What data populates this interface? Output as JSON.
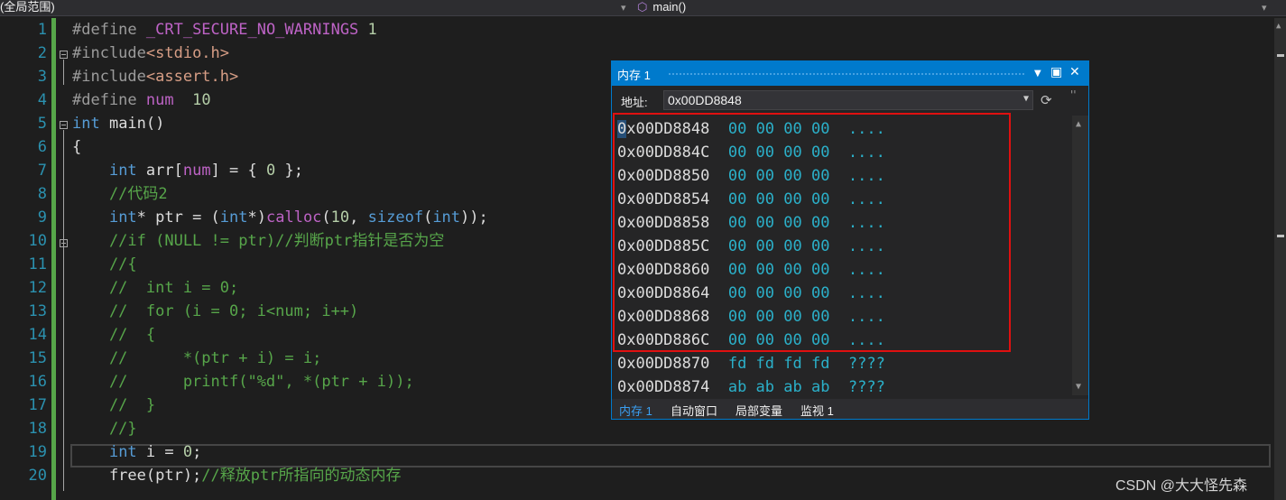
{
  "scope_bar": {
    "scope": "(全局范围)",
    "function": "main()"
  },
  "code": {
    "line_numbers": [
      "1",
      "2",
      "3",
      "4",
      "5",
      "6",
      "7",
      "8",
      "9",
      "10",
      "11",
      "12",
      "13",
      "14",
      "15",
      "16",
      "17",
      "18",
      "19",
      "20"
    ],
    "lines": [
      [
        [
          "pp",
          "#define "
        ],
        [
          "mac",
          "_CRT_SECURE_NO_WARNINGS"
        ],
        [
          "pl",
          " "
        ],
        [
          "num",
          "1"
        ]
      ],
      [
        [
          "pp",
          "#include"
        ],
        [
          "str",
          "<stdio.h>"
        ]
      ],
      [
        [
          "pp",
          "#include"
        ],
        [
          "str",
          "<assert.h>"
        ]
      ],
      [
        [
          "pp",
          "#define "
        ],
        [
          "mac",
          "num"
        ],
        [
          "pl",
          "  "
        ],
        [
          "num",
          "10"
        ]
      ],
      [
        [
          "kw",
          "int"
        ],
        [
          "pl",
          " main()"
        ]
      ],
      [
        [
          "pl",
          "{"
        ]
      ],
      [
        [
          "pl",
          "    "
        ],
        [
          "kw",
          "int"
        ],
        [
          "pl",
          " arr["
        ],
        [
          "mac",
          "num"
        ],
        [
          "pl",
          "] = { "
        ],
        [
          "num",
          "0"
        ],
        [
          "pl",
          " };"
        ]
      ],
      [
        [
          "cm",
          "    //代码2"
        ]
      ],
      [
        [
          "pl",
          "    "
        ],
        [
          "kw",
          "int"
        ],
        [
          "pl",
          "* ptr = ("
        ],
        [
          "kw",
          "int"
        ],
        [
          "pl",
          "*)"
        ],
        [
          "mac",
          "calloc"
        ],
        [
          "pl",
          "("
        ],
        [
          "num",
          "10"
        ],
        [
          "pl",
          ", "
        ],
        [
          "kw",
          "sizeof"
        ],
        [
          "pl",
          "("
        ],
        [
          "kw",
          "int"
        ],
        [
          "pl",
          "));"
        ]
      ],
      [
        [
          "cm",
          "    //if (NULL != ptr)//判断ptr指针是否为空"
        ]
      ],
      [
        [
          "cm",
          "    //{"
        ]
      ],
      [
        [
          "cm",
          "    //  int i = 0;"
        ]
      ],
      [
        [
          "cm",
          "    //  for (i = 0; i<num; i++)"
        ]
      ],
      [
        [
          "cm",
          "    //  {"
        ]
      ],
      [
        [
          "cm",
          "    //      *(ptr + i) = i;"
        ]
      ],
      [
        [
          "cm",
          "    //      printf(\"%d\", *(ptr + i));"
        ]
      ],
      [
        [
          "cm",
          "    //  }"
        ]
      ],
      [
        [
          "cm",
          "    //}"
        ]
      ],
      [
        [
          "pl",
          "    "
        ],
        [
          "kw",
          "int"
        ],
        [
          "pl",
          " i = "
        ],
        [
          "num",
          "0"
        ],
        [
          "pl",
          ";"
        ]
      ],
      [
        [
          "pl",
          "    free(ptr);"
        ],
        [
          "cm",
          "//释放ptr所指向的动态内存"
        ]
      ]
    ]
  },
  "memory_window": {
    "title": "内存 1",
    "address_label": "地址:",
    "address_value": "0x00DD8848",
    "rows": [
      {
        "addr": "0x00DD8848",
        "bytes": "00 00 00 00",
        "ascii": "...."
      },
      {
        "addr": "0x00DD884C",
        "bytes": "00 00 00 00",
        "ascii": "...."
      },
      {
        "addr": "0x00DD8850",
        "bytes": "00 00 00 00",
        "ascii": "...."
      },
      {
        "addr": "0x00DD8854",
        "bytes": "00 00 00 00",
        "ascii": "...."
      },
      {
        "addr": "0x00DD8858",
        "bytes": "00 00 00 00",
        "ascii": "...."
      },
      {
        "addr": "0x00DD885C",
        "bytes": "00 00 00 00",
        "ascii": "...."
      },
      {
        "addr": "0x00DD8860",
        "bytes": "00 00 00 00",
        "ascii": "...."
      },
      {
        "addr": "0x00DD8864",
        "bytes": "00 00 00 00",
        "ascii": "...."
      },
      {
        "addr": "0x00DD8868",
        "bytes": "00 00 00 00",
        "ascii": "...."
      },
      {
        "addr": "0x00DD886C",
        "bytes": "00 00 00 00",
        "ascii": "...."
      },
      {
        "addr": "0x00DD8870",
        "bytes": "fd fd fd fd",
        "ascii": "????"
      },
      {
        "addr": "0x00DD8874",
        "bytes": "ab ab ab ab",
        "ascii": "????"
      }
    ],
    "tabs": [
      "内存 1",
      "自动窗口",
      "局部变量",
      "监视 1"
    ]
  },
  "watermark": "CSDN @大大怪先森",
  "colors": {
    "accent": "#007acc",
    "highlight_box": "#e01010",
    "change_bar": "#57a64a"
  }
}
